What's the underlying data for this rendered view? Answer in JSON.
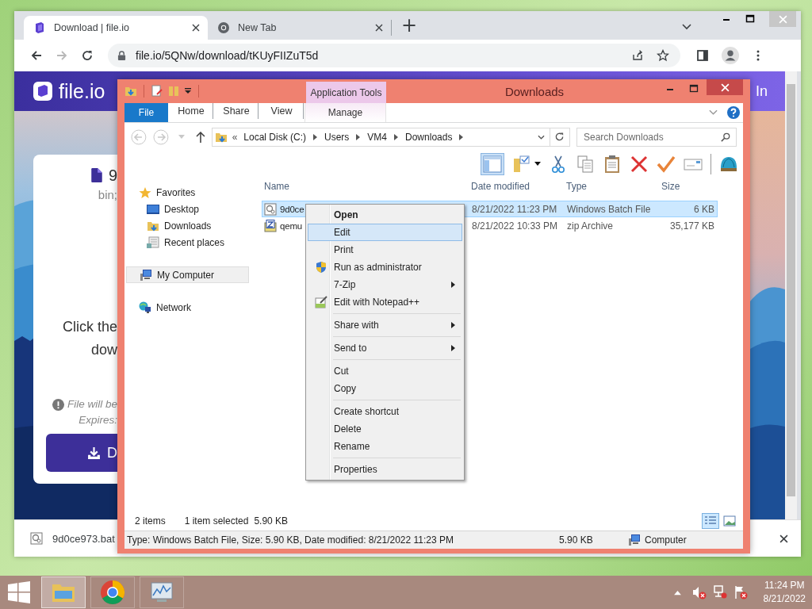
{
  "browser": {
    "tabs": [
      {
        "title": "Download | file.io",
        "selected": true
      },
      {
        "title": "New Tab",
        "selected": false
      }
    ],
    "new_tab": "+",
    "url": "file.io/5QNw/download/tKUyFIIZuT5d",
    "page": {
      "logo": "file.io",
      "header_link": "In",
      "file_name": "9",
      "file_meta": "bin;",
      "instruction": [
        "Click the",
        "dow"
      ],
      "notice": [
        "File will be",
        "Expires:"
      ],
      "download_button": "D"
    },
    "download_bar": {
      "file": "9d0ce973.bat"
    }
  },
  "explorer": {
    "title": "Downloads",
    "context_tab": "Application Tools",
    "ribbon_tabs": [
      {
        "label": "File",
        "kind": "file",
        "selected": true
      },
      {
        "label": "Home",
        "kind": "tab",
        "selected": false
      },
      {
        "label": "Share",
        "kind": "tab",
        "selected": false
      },
      {
        "label": "View",
        "kind": "tab",
        "selected": false
      },
      {
        "label": "Manage",
        "kind": "context",
        "selected": false
      }
    ],
    "overflow_mark": "«",
    "breadcrumb": [
      "Local Disk (C:)",
      "Users",
      "VM4",
      "Downloads"
    ],
    "search": {
      "placeholder": "Search Downloads"
    },
    "nav": [
      {
        "label": "Favorites",
        "selected": false,
        "children": [
          {
            "label": "Desktop",
            "selected": false
          },
          {
            "label": "Downloads",
            "selected": false
          },
          {
            "label": "Recent places",
            "selected": false
          }
        ]
      },
      {
        "label": "My Computer",
        "selected": true
      },
      {
        "label": "Network",
        "selected": false
      }
    ],
    "columns": [
      "Name",
      "Date modified",
      "Type",
      "Size"
    ],
    "files": [
      {
        "name": "9d0ce",
        "modified": "8/21/2022 11:23 PM",
        "type": "Windows Batch File",
        "size": "6 KB",
        "kind": "bat",
        "selected": true
      },
      {
        "name": "qemu",
        "modified": "8/21/2022 10:33 PM",
        "type": "zip Archive",
        "size": "35,177 KB",
        "kind": "zip",
        "selected": false
      }
    ],
    "status": {
      "count": "2 items",
      "selection": "1 item selected",
      "selection_size": "5.90 KB"
    },
    "details": {
      "text": "Type: Windows Batch File, Size: 5.90 KB, Date modified: 8/21/2022 11:23 PM",
      "size": "5.90 KB",
      "zone": "Computer"
    }
  },
  "context_menu": {
    "groups": [
      [
        {
          "label": "Open",
          "default": true,
          "selected": false,
          "submenu": false
        },
        {
          "label": "Edit",
          "default": false,
          "selected": true,
          "submenu": false
        },
        {
          "label": "Print",
          "default": false,
          "selected": false,
          "submenu": false
        },
        {
          "label": "Run as administrator",
          "kind": "elevated",
          "default": false,
          "selected": false,
          "submenu": false
        },
        {
          "label": "7-Zip",
          "default": false,
          "selected": false,
          "submenu": true
        },
        {
          "label": "Edit with Notepad++",
          "kind": "plugin",
          "default": false,
          "selected": false,
          "submenu": false
        }
      ],
      [
        {
          "label": "Share with",
          "default": false,
          "selected": false,
          "submenu": true
        }
      ],
      [
        {
          "label": "Send to",
          "default": false,
          "selected": false,
          "submenu": true
        }
      ],
      [
        {
          "label": "Cut",
          "default": false,
          "selected": false,
          "submenu": false
        },
        {
          "label": "Copy",
          "default": false,
          "selected": false,
          "submenu": false
        }
      ],
      [
        {
          "label": "Create shortcut",
          "default": false,
          "selected": false,
          "submenu": false
        },
        {
          "label": "Delete",
          "default": false,
          "selected": false,
          "submenu": false
        },
        {
          "label": "Rename",
          "default": false,
          "selected": false,
          "submenu": false
        }
      ],
      [
        {
          "label": "Properties",
          "default": false,
          "selected": false,
          "submenu": false
        }
      ]
    ]
  },
  "taskbar": {
    "apps": [
      {
        "kind": "explorer",
        "active": true
      },
      {
        "kind": "chrome",
        "active": false
      },
      {
        "kind": "monitor",
        "active": false
      }
    ],
    "time": "11:24 PM",
    "date": "8/21/2022"
  }
}
